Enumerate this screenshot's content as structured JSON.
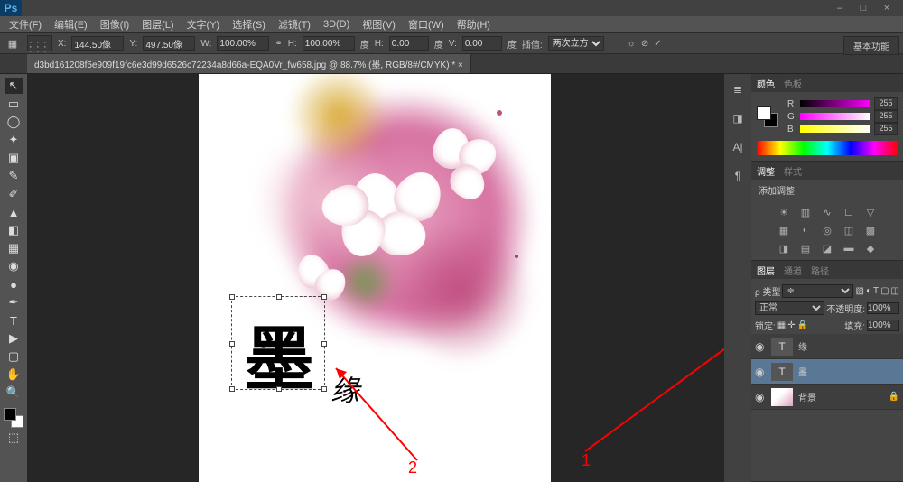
{
  "app": {
    "name": "Ps"
  },
  "window_buttons": {
    "min": "–",
    "max": "□",
    "close": "×"
  },
  "menu": [
    "文件(F)",
    "编辑(E)",
    "图像(I)",
    "图层(L)",
    "文字(Y)",
    "选择(S)",
    "滤镜(T)",
    "3D(D)",
    "视图(V)",
    "窗口(W)",
    "帮助(H)"
  ],
  "options": {
    "x": {
      "label": "X:",
      "value": "144.50像"
    },
    "y": {
      "label": "Y:",
      "value": "497.50像"
    },
    "w": {
      "label": "W:",
      "value": "100.00%"
    },
    "h": {
      "label": "H:",
      "value": "100.00%"
    },
    "deg1": {
      "label": "度",
      "value": ""
    },
    "h2": {
      "label": "H:",
      "value": "0.00"
    },
    "deg2": {
      "label": "度",
      "value": ""
    },
    "v": {
      "label": "V:",
      "value": "0.00"
    },
    "deg3": {
      "label": "度",
      "value": ""
    },
    "interp": {
      "label": "插值:",
      "value": "两次立方"
    },
    "right_btn": "基本功能"
  },
  "document_tab": "d3bd161208f5e909f19fc6e3d99d6526c72234a8d66a-EQA0Vr_fw658.jpg @ 88.7% (墨, RGB/8#/CMYK) * ×",
  "canvas": {
    "big_char": "墨",
    "small_char": "缘"
  },
  "annotations": {
    "one": "1",
    "two": "2"
  },
  "panels": {
    "color": {
      "tabs": [
        "颜色",
        "色板"
      ],
      "channels": [
        {
          "lbl": "R",
          "val": "255"
        },
        {
          "lbl": "G",
          "val": "255"
        },
        {
          "lbl": "B",
          "val": "255"
        }
      ]
    },
    "adjust": {
      "tabs": [
        "调整",
        "样式"
      ],
      "title": "添加调整"
    },
    "layers": {
      "tabs": [
        "图层",
        "通道",
        "路径"
      ],
      "kind_label": "ρ 类型",
      "blend": "正常",
      "opacity_label": "不透明度:",
      "opacity": "100%",
      "lock_label": "锁定:",
      "fill_label": "填充:",
      "fill": "100%",
      "items": [
        {
          "name": "缘",
          "type": "T",
          "selected": false
        },
        {
          "name": "墨",
          "type": "T",
          "selected": true
        },
        {
          "name": "背景",
          "type": "img",
          "selected": false,
          "locked": true
        }
      ]
    }
  },
  "tools_left": [
    "↖",
    "▭",
    "◯",
    "✂",
    "✎",
    "✐",
    "⊡",
    "⟋",
    "◉",
    "T",
    "▶",
    "✋",
    "🔍",
    "⬚"
  ]
}
